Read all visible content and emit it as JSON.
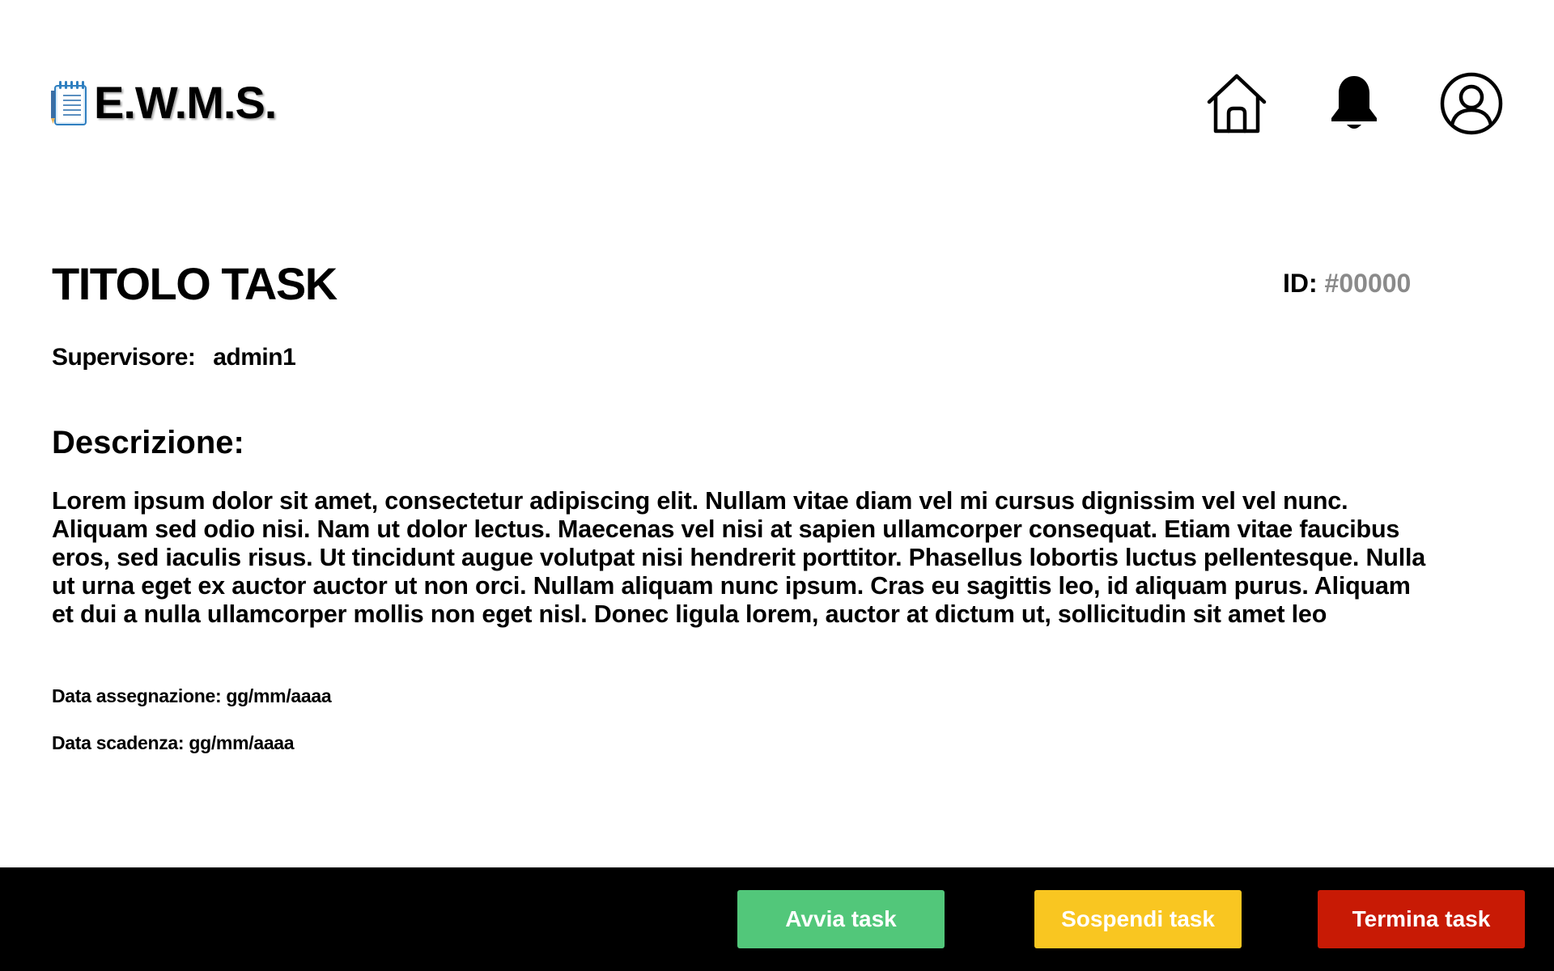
{
  "header": {
    "app_name": "E.W.M.S.",
    "logo_icon": "notepad-icon",
    "nav_icons": [
      "home-icon",
      "bell-icon",
      "user-profile-icon"
    ]
  },
  "task": {
    "title": "TITOLO TASK",
    "id_label": "ID:",
    "id_value": "#00000",
    "supervisor_label": "Supervisore:",
    "supervisor_value": "admin1",
    "description_heading": "Descrizione:",
    "description": "Lorem ipsum dolor sit amet, consectetur adipiscing elit. Nullam vitae diam vel mi cursus dignissim vel vel nunc. Aliquam sed odio nisi. Nam ut dolor lectus. Maecenas vel nisi at sapien ullamcorper consequat. Etiam vitae faucibus eros, sed iaculis risus. Ut tincidunt augue volutpat nisi hendrerit porttitor. Phasellus lobortis luctus pellentesque. Nulla ut urna eget ex auctor auctor ut non orci. Nullam aliquam nunc ipsum. Cras eu sagittis leo, id aliquam purus. Aliquam et dui a nulla ullamcorper mollis non eget nisl. Donec ligula lorem, auctor at dictum ut, sollicitudin sit amet leo",
    "assignment_date": "Data assegnazione: gg/mm/aaaa",
    "due_date": "Data scadenza: gg/mm/aaaa"
  },
  "actions": {
    "start_label": "Avvia task",
    "suspend_label": "Sospendi task",
    "end_label": "Termina task"
  },
  "colors": {
    "start": "#52c77a",
    "suspend": "#f9c621",
    "end": "#c81a05",
    "footer_bg": "#000000",
    "id_value": "#8a8a8a"
  }
}
